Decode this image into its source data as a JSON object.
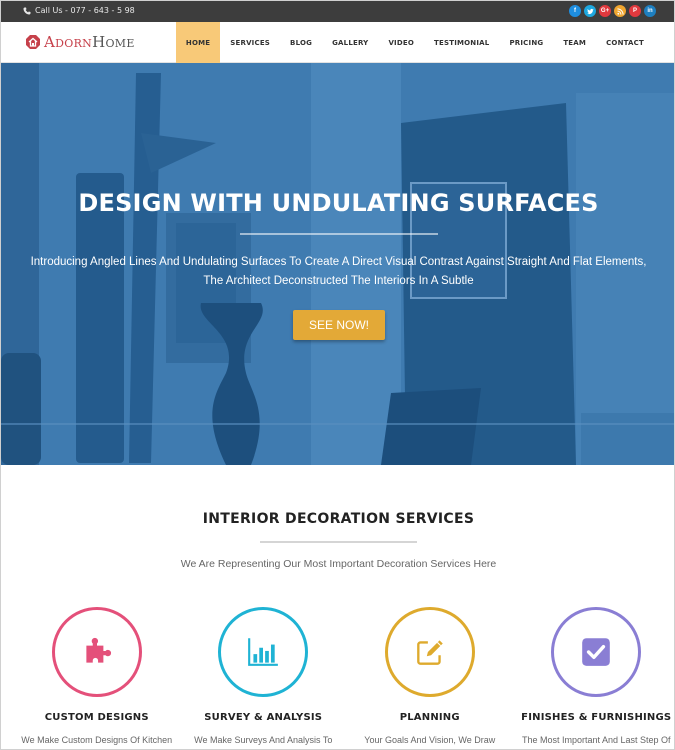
{
  "topbar": {
    "call_label": "Call Us - 077 - 643 - 5 98",
    "socials": [
      {
        "name": "facebook",
        "glyph": "f",
        "color": "#1e8ee0"
      },
      {
        "name": "twitter",
        "glyph": "t",
        "color": "#1ea8e0"
      },
      {
        "name": "google-plus",
        "glyph": "G+",
        "color": "#e0393e"
      },
      {
        "name": "rss",
        "glyph": "rss",
        "color": "#f0a630"
      },
      {
        "name": "pinterest",
        "glyph": "P",
        "color": "#e0393e"
      },
      {
        "name": "linkedin",
        "glyph": "in",
        "color": "#1e7fc0"
      }
    ]
  },
  "header": {
    "logo_part1": "Adorn",
    "logo_part2": "Home",
    "nav": [
      "HOME",
      "SERVICES",
      "BLOG",
      "GALLERY",
      "VIDEO",
      "TESTIMONIAL",
      "PRICING",
      "TEAM",
      "CONTACT"
    ],
    "active_nav": "HOME"
  },
  "hero": {
    "title": "DESIGN WITH UNDULATING SURFACES",
    "subtitle_line1": "Introducing Angled Lines And Undulating Surfaces To Create A Direct Visual Contrast Against Straight And Flat Elements,",
    "subtitle_line2": "The Architect Deconstructed The Interiors In A Subtle",
    "button_label": "SEE NOW!"
  },
  "services": {
    "title": "INTERIOR DECORATION SERVICES",
    "subtitle": "We Are Representing Our Most Important Decoration Services Here",
    "cards": [
      {
        "title": "CUSTOM DESIGNS",
        "desc": "We Make Custom Designs Of Kitchen",
        "icon": "puzzle-icon",
        "color": "#e4507a"
      },
      {
        "title": "SURVEY & ANALYSIS",
        "desc": "We Make Surveys And Analysis To",
        "icon": "bar-chart-icon",
        "color": "#1fb3d4"
      },
      {
        "title": "PLANNING",
        "desc": "Your Goals And Vision, We Draw",
        "icon": "edit-icon",
        "color": "#deaa2d"
      },
      {
        "title": "FINISHES & FURNISHINGS",
        "desc": "The Most Important And Last Step Of",
        "icon": "checkbox-icon",
        "color": "#8a7ed4"
      }
    ]
  }
}
